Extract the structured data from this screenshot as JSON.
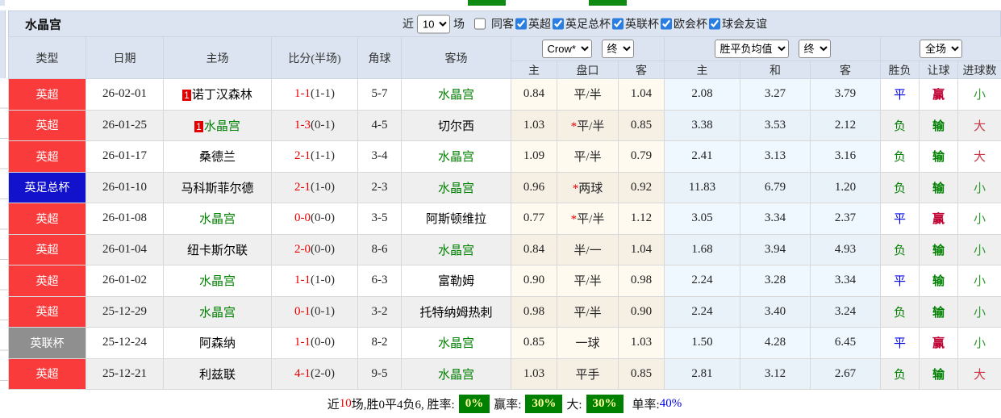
{
  "title": "水晶宫",
  "filters": {
    "recent_label": "近",
    "recent_count": "10",
    "matches_label": "场",
    "checkboxes": [
      {
        "key": "same-away",
        "label": "同客",
        "checked": false
      },
      {
        "key": "epl",
        "label": "英超",
        "checked": true
      },
      {
        "key": "fa-cup",
        "label": "英足总杯",
        "checked": true
      },
      {
        "key": "league-cup",
        "label": "英联杯",
        "checked": true
      },
      {
        "key": "conference-league",
        "label": "欧会杯",
        "checked": true
      },
      {
        "key": "club-friendly",
        "label": "球会友谊",
        "checked": true
      }
    ]
  },
  "colors": {
    "epl_red": "#fa3b3b",
    "facup_blue": "#1212cd",
    "league_cup_gray": "#8f8f8f",
    "crystal_palace_green": "#008000",
    "score_red": "#e80000",
    "win_red": "#c00032",
    "draw_blue": "#0000e6",
    "badge_green": "#008000",
    "badge_text_yellow": "#ffff99",
    "header_blue": "#dbe4f0"
  },
  "table": {
    "columns": {
      "type": "类型",
      "date": "日期",
      "home": "主场",
      "score": "比分(半场)",
      "corner": "角球",
      "away": "客场"
    },
    "odds_group": {
      "select1": "Crow*",
      "select2": "终",
      "sub": [
        "主",
        "盘口",
        "客"
      ]
    },
    "avg_group": {
      "select1": "胜平负均值",
      "select2": "终",
      "sub": [
        "主",
        "和",
        "客"
      ]
    },
    "result_group": {
      "select": "全场",
      "sub": [
        "胜负",
        "让球",
        "进球数"
      ]
    },
    "rows": [
      {
        "type": "英超",
        "type_class": "epl",
        "date": "26-02-01",
        "home": "诺丁汉森林",
        "home_rank": "1",
        "home_cp": false,
        "score": "1-1",
        "half": "(1-1)",
        "corner": "5-7",
        "away": "水晶宫",
        "away_cp": true,
        "odds_home": "0.84",
        "handicap_star": false,
        "handicap": "平/半",
        "odds_away": "1.04",
        "avg_home": "2.08",
        "avg_draw": "3.27",
        "avg_away": "3.79",
        "wl": "平",
        "wl_class": "draw",
        "hc": "赢",
        "hc_class": "win",
        "goal": "小",
        "goal_class": "small"
      },
      {
        "type": "英超",
        "type_class": "epl",
        "date": "26-01-25",
        "home": "水晶宫",
        "home_rank": "1",
        "home_cp": true,
        "score": "1-3",
        "half": "(0-1)",
        "corner": "4-5",
        "away": "切尔西",
        "away_cp": false,
        "odds_home": "1.03",
        "handicap_star": true,
        "handicap": "平/半",
        "odds_away": "0.85",
        "avg_home": "3.38",
        "avg_draw": "3.53",
        "avg_away": "2.12",
        "wl": "负",
        "wl_class": "lose",
        "hc": "输",
        "hc_class": "loss",
        "goal": "大",
        "goal_class": "big"
      },
      {
        "type": "英超",
        "type_class": "epl",
        "date": "26-01-17",
        "home": "桑德兰",
        "home_rank": "",
        "home_cp": false,
        "score": "2-1",
        "half": "(1-1)",
        "corner": "3-4",
        "away": "水晶宫",
        "away_cp": true,
        "odds_home": "1.09",
        "handicap_star": false,
        "handicap": "平/半",
        "odds_away": "0.79",
        "avg_home": "2.41",
        "avg_draw": "3.13",
        "avg_away": "3.16",
        "wl": "负",
        "wl_class": "lose",
        "hc": "输",
        "hc_class": "loss",
        "goal": "大",
        "goal_class": "big"
      },
      {
        "type": "英足总杯",
        "type_class": "facup",
        "date": "26-01-10",
        "home": "马科斯菲尔德",
        "home_rank": "",
        "home_cp": false,
        "score": "2-1",
        "half": "(1-0)",
        "corner": "2-3",
        "away": "水晶宫",
        "away_cp": true,
        "odds_home": "0.96",
        "handicap_star": true,
        "handicap": "两球",
        "odds_away": "0.92",
        "avg_home": "11.83",
        "avg_draw": "6.79",
        "avg_away": "1.20",
        "wl": "负",
        "wl_class": "lose",
        "hc": "输",
        "hc_class": "loss",
        "goal": "小",
        "goal_class": "small"
      },
      {
        "type": "英超",
        "type_class": "epl",
        "date": "26-01-08",
        "home": "水晶宫",
        "home_rank": "",
        "home_cp": true,
        "score": "0-0",
        "half": "(0-0)",
        "corner": "3-5",
        "away": "阿斯顿维拉",
        "away_cp": false,
        "odds_home": "0.77",
        "handicap_star": true,
        "handicap": "平/半",
        "odds_away": "1.12",
        "avg_home": "3.05",
        "avg_draw": "3.34",
        "avg_away": "2.37",
        "wl": "平",
        "wl_class": "draw",
        "hc": "赢",
        "hc_class": "win",
        "goal": "小",
        "goal_class": "small"
      },
      {
        "type": "英超",
        "type_class": "epl",
        "date": "26-01-04",
        "home": "纽卡斯尔联",
        "home_rank": "",
        "home_cp": false,
        "score": "2-0",
        "half": "(0-0)",
        "corner": "8-6",
        "away": "水晶宫",
        "away_cp": true,
        "odds_home": "0.84",
        "handicap_star": false,
        "handicap": "半/一",
        "odds_away": "1.04",
        "avg_home": "1.68",
        "avg_draw": "3.94",
        "avg_away": "4.93",
        "wl": "负",
        "wl_class": "lose",
        "hc": "输",
        "hc_class": "loss",
        "goal": "小",
        "goal_class": "small"
      },
      {
        "type": "英超",
        "type_class": "epl",
        "date": "26-01-02",
        "home": "水晶宫",
        "home_rank": "",
        "home_cp": true,
        "score": "1-1",
        "half": "(1-0)",
        "corner": "6-3",
        "away": "富勒姆",
        "away_cp": false,
        "odds_home": "0.90",
        "handicap_star": false,
        "handicap": "平/半",
        "odds_away": "0.98",
        "avg_home": "2.24",
        "avg_draw": "3.28",
        "avg_away": "3.34",
        "wl": "平",
        "wl_class": "draw",
        "hc": "输",
        "hc_class": "loss",
        "goal": "小",
        "goal_class": "small"
      },
      {
        "type": "英超",
        "type_class": "epl",
        "date": "25-12-29",
        "home": "水晶宫",
        "home_rank": "",
        "home_cp": true,
        "score": "0-1",
        "half": "(0-1)",
        "corner": "3-2",
        "away": "托特纳姆热刺",
        "away_cp": false,
        "odds_home": "0.98",
        "handicap_star": false,
        "handicap": "平/半",
        "odds_away": "0.90",
        "avg_home": "2.24",
        "avg_draw": "3.40",
        "avg_away": "3.24",
        "wl": "负",
        "wl_class": "lose",
        "hc": "输",
        "hc_class": "loss",
        "goal": "小",
        "goal_class": "small"
      },
      {
        "type": "英联杯",
        "type_class": "lcup",
        "date": "25-12-24",
        "home": "阿森纳",
        "home_rank": "",
        "home_cp": false,
        "score": "1-1",
        "half": "(0-0)",
        "corner": "8-2",
        "away": "水晶宫",
        "away_cp": true,
        "odds_home": "0.85",
        "handicap_star": false,
        "handicap": "一球",
        "odds_away": "1.03",
        "avg_home": "1.50",
        "avg_draw": "4.28",
        "avg_away": "6.45",
        "wl": "平",
        "wl_class": "draw",
        "hc": "赢",
        "hc_class": "win",
        "goal": "小",
        "goal_class": "small"
      },
      {
        "type": "英超",
        "type_class": "epl",
        "date": "25-12-21",
        "home": "利兹联",
        "home_rank": "",
        "home_cp": false,
        "score": "4-1",
        "half": "(2-0)",
        "corner": "9-5",
        "away": "水晶宫",
        "away_cp": true,
        "odds_home": "1.03",
        "handicap_star": false,
        "handicap": "平手",
        "odds_away": "0.85",
        "avg_home": "2.81",
        "avg_draw": "3.12",
        "avg_away": "2.67",
        "wl": "负",
        "wl_class": "lose",
        "hc": "输",
        "hc_class": "loss",
        "goal": "大",
        "goal_class": "big"
      }
    ]
  },
  "footer": {
    "seg1": "近",
    "count": "10",
    "seg2": "场,胜0平4负6, 胜率:",
    "badge1": "0%",
    "seg3": "赢率:",
    "badge2": "30%",
    "seg4": "大:",
    "badge3": "30%",
    "seg5": "单率:",
    "pct": "40%"
  }
}
